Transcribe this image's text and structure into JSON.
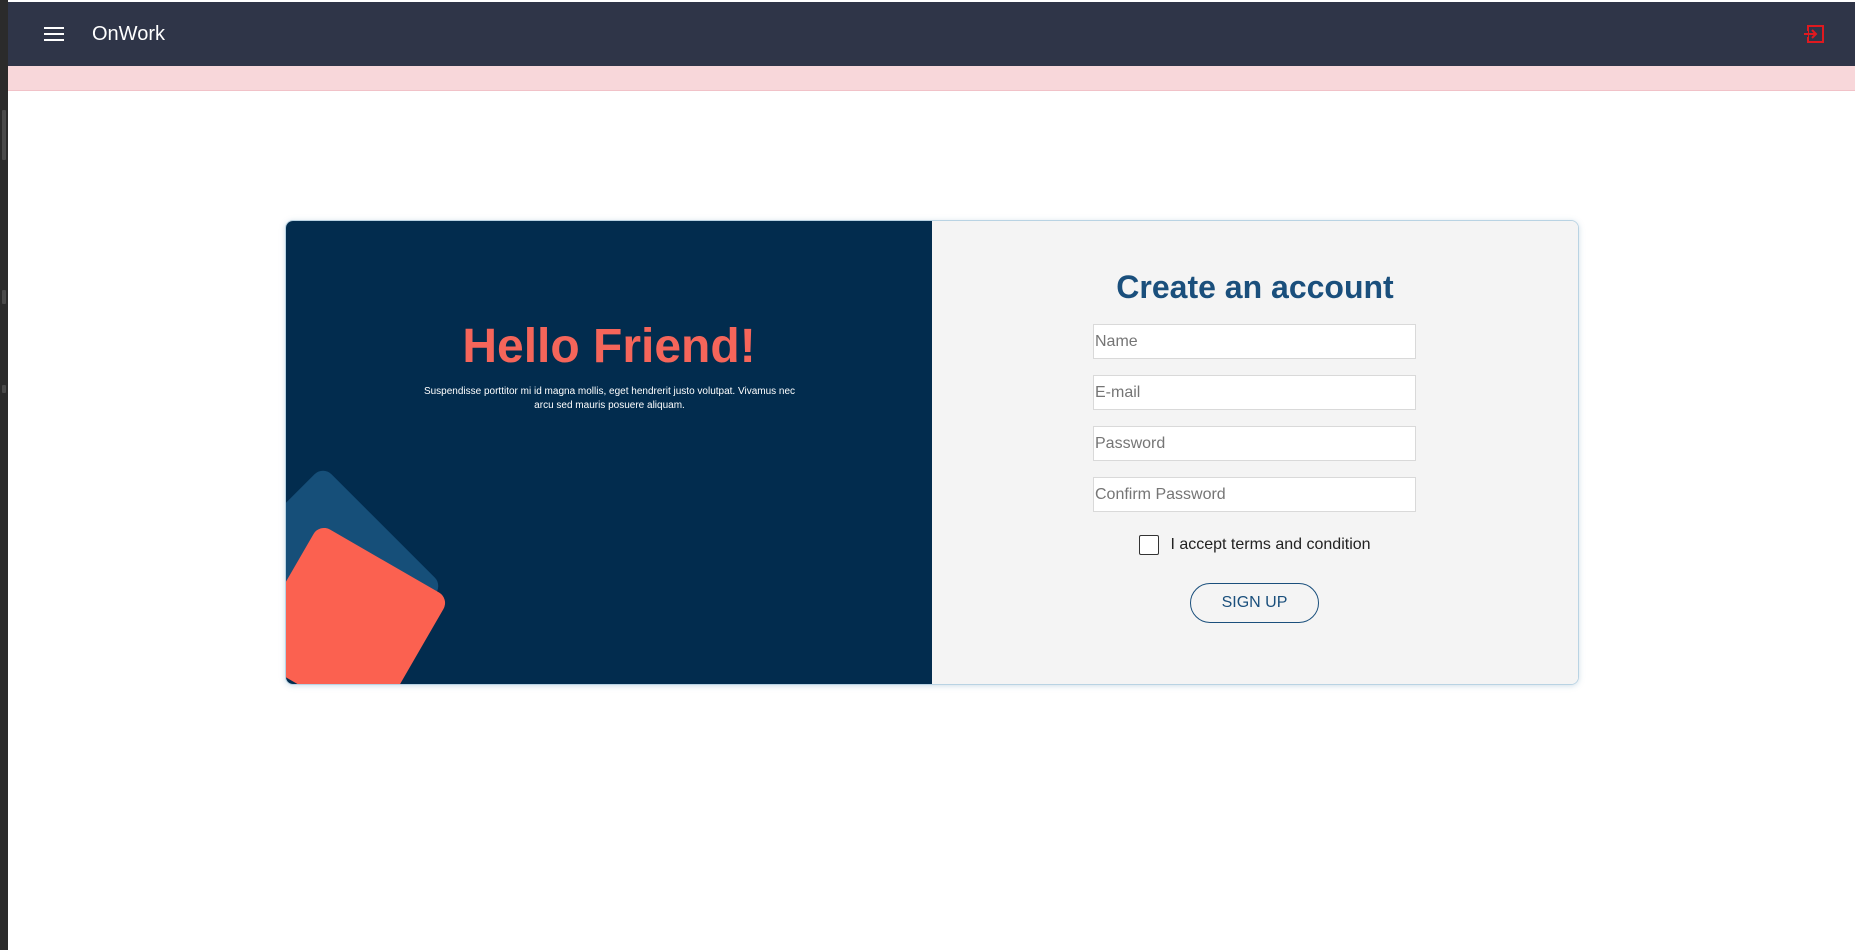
{
  "header": {
    "title": "OnWork",
    "menu_icon": "hamburger-menu-icon",
    "logout_icon": "logout-icon",
    "logout_color": "#e0191f",
    "background": "#2f3548"
  },
  "alert": {
    "background": "#f8d7da"
  },
  "welcome": {
    "heading": "Hello Friend!",
    "text": "Suspendisse porttitor mi id magna mollis, eget hendrerit justo volutpat. Vivamus nec arcu sed mauris posuere aliquam.",
    "heading_color": "#f5655a",
    "background": "#022c4e"
  },
  "signup_form": {
    "title": "Create an account",
    "fields": [
      {
        "name": "name",
        "placeholder": "Name",
        "value": ""
      },
      {
        "name": "email",
        "placeholder": "E-mail",
        "value": ""
      },
      {
        "name": "password",
        "placeholder": "Password",
        "value": ""
      },
      {
        "name": "confirm_password",
        "placeholder": "Confirm Password",
        "value": ""
      }
    ],
    "terms_label": "I accept terms and condition",
    "terms_checked": false,
    "submit_label": "SIGN UP",
    "accent_color": "#1a4f7c"
  }
}
